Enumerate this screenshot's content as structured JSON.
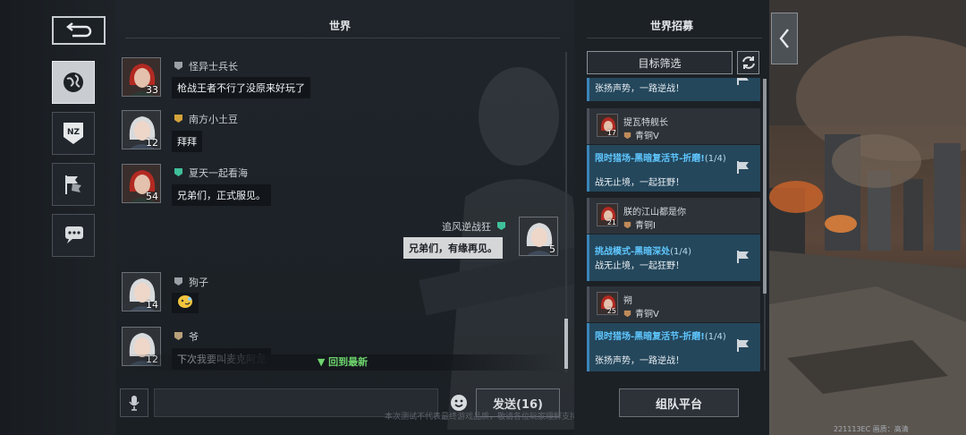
{
  "rail": {
    "items": [
      {
        "name": "back-button",
        "icon": "back-arrow-icon"
      },
      {
        "name": "world-tab",
        "icon": "globe-icon",
        "active": true
      },
      {
        "name": "team-tab",
        "icon": "nz-shield-icon"
      },
      {
        "name": "recruit-tab",
        "icon": "flags-icon"
      },
      {
        "name": "private-chat-tab",
        "icon": "chat-bubble-icon"
      }
    ]
  },
  "chat": {
    "title": "世界",
    "messages": [
      {
        "user": "怪异士兵长",
        "level": "33",
        "text": "枪战王者不行了没原来好玩了",
        "side": "left"
      },
      {
        "user": "南方小土豆",
        "level": "12",
        "text": "拜拜",
        "side": "left"
      },
      {
        "user": "夏天一起看海",
        "level": "54",
        "text": "兄弟们，正式服见。",
        "side": "left"
      },
      {
        "user": "追风逆战狂",
        "level": "5",
        "text": "兄弟们，有缘再见。",
        "side": "right"
      },
      {
        "user": "狗子",
        "level": "14",
        "text": "",
        "side": "left"
      },
      {
        "user": "爷",
        "level": "12",
        "text": "下次我要叫麦克阿龙",
        "side": "left"
      }
    ],
    "newest_label": "▼ 回到最新",
    "send_label": "发送(16)",
    "footer_note": "本次测试不代表最终游戏品质，敬请各位玩家理解支持"
  },
  "recruit": {
    "title": "世界招募",
    "filter_label": "目标筛选",
    "top_partial_slogan": "张扬声势，一路逆战！",
    "cards": [
      {
        "leader": "提瓦特舰长",
        "level": "17",
        "tier": "青铜V",
        "mode": "限时猎场-黑暗复活节-折磨!",
        "count": "(1/4)",
        "slogan": "战无止境，一起狂野！"
      },
      {
        "leader": "朕的江山都是你",
        "level": "21",
        "tier": "青铜I",
        "mode": "挑战模式-黑暗深处",
        "count": "(1/4)",
        "slogan": "战无止境，一起狂野！"
      },
      {
        "leader": "朔",
        "level": "25",
        "tier": "青铜V",
        "mode": "限时猎场-黑暗复活节-折磨!",
        "count": "(1/4)",
        "slogan": "张扬声势，一路逆战！"
      }
    ],
    "team_platform_label": "组队平台"
  },
  "scene": {
    "version": "221113EC  画质：高清"
  },
  "colors": {
    "accent_blue": "#5fc7ff",
    "newest_green": "#6ed66e",
    "card_body": "#24475c"
  }
}
